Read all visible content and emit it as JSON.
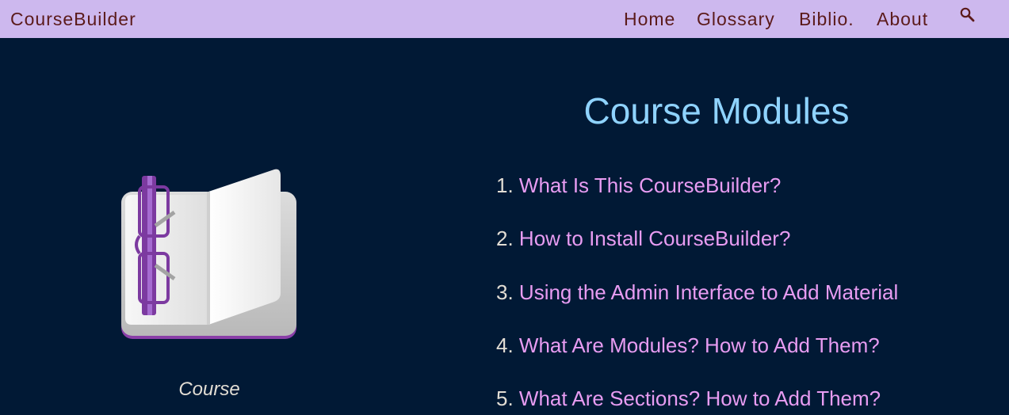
{
  "navbar": {
    "brand": "CourseBuilder",
    "links": [
      "Home",
      "Glossary",
      "Biblio.",
      "About"
    ],
    "search_icon": "search-icon"
  },
  "hero": {
    "logo_icon": "open-book-with-glasses-icon",
    "caption": "Course"
  },
  "modules": {
    "title": "Course Modules",
    "items": [
      {
        "number": "1.",
        "label": "What Is This CourseBuilder?"
      },
      {
        "number": "2.",
        "label": "How to Install CourseBuilder?"
      },
      {
        "number": "3.",
        "label": "Using the Admin Interface to Add Material"
      },
      {
        "number": "4.",
        "label": "What Are Modules? How to Add Them?"
      },
      {
        "number": "5.",
        "label": "What Are Sections? How to Add Them?"
      }
    ]
  },
  "colors": {
    "navbar_bg": "#cdb8ee",
    "nav_text": "#5b1a1a",
    "page_bg": "#011935",
    "title": "#8fd3ff",
    "link": "#e89cf2",
    "number": "#e2ddd4"
  }
}
